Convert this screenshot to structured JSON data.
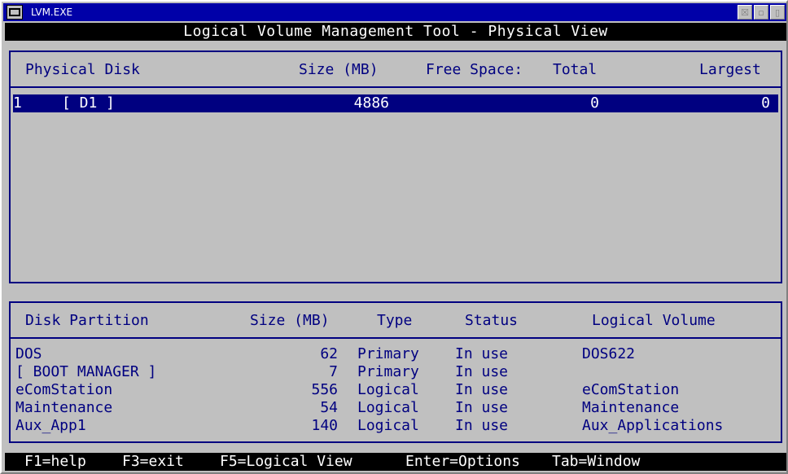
{
  "window": {
    "title": "LVM.EXE",
    "buttons": [
      "☒",
      "▫",
      "▯"
    ]
  },
  "header": {
    "title": "Logical Volume Management Tool - Physical View"
  },
  "physical_panel": {
    "columns": {
      "disk": "Physical Disk",
      "size": "Size (MB)",
      "free_space": "Free Space:",
      "total": "Total",
      "largest": "Largest"
    },
    "rows": [
      {
        "num": "1",
        "name": "[ D1 ]",
        "size": "4886",
        "total": "0",
        "largest": "0"
      }
    ]
  },
  "partition_panel": {
    "columns": {
      "partition": "Disk Partition",
      "size": "Size (MB)",
      "type": "Type",
      "status": "Status",
      "volume": "Logical Volume"
    },
    "rows": [
      {
        "name": "DOS",
        "size": "62",
        "type": "Primary",
        "status": "In use",
        "volume": "DOS622"
      },
      {
        "name": "[ BOOT MANAGER ]",
        "size": "7",
        "type": "Primary",
        "status": "In use",
        "volume": ""
      },
      {
        "name": "eComStation",
        "size": "556",
        "type": "Logical",
        "status": "In use",
        "volume": "eComStation"
      },
      {
        "name": "Maintenance",
        "size": "54",
        "type": "Logical",
        "status": "In use",
        "volume": "Maintenance"
      },
      {
        "name": "Aux_App1",
        "size": "140",
        "type": "Logical",
        "status": "In use",
        "volume": "Aux_Applications"
      }
    ]
  },
  "footer": {
    "keys": {
      "help": "F1=help",
      "exit": "F3=exit",
      "logical": "F5=Logical View",
      "enter": "Enter=Options",
      "tab": "Tab=Window"
    }
  }
}
